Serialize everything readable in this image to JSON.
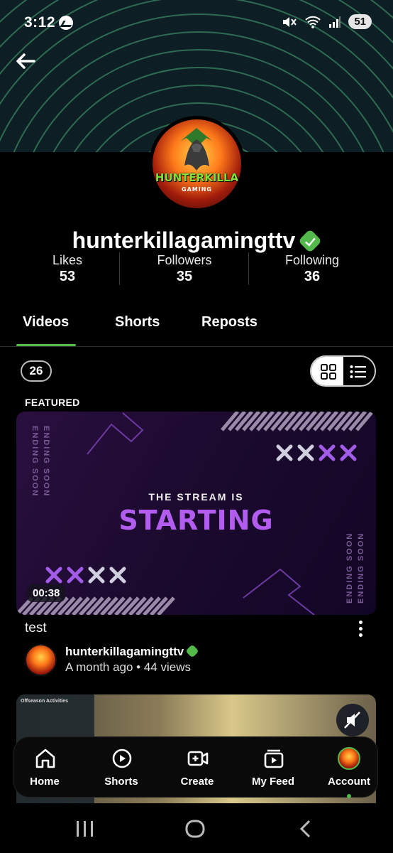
{
  "status_bar": {
    "time": "3:12",
    "battery": "51",
    "icons": [
      "messenger-icon",
      "mute-icon",
      "wifi-icon",
      "signal-icon"
    ]
  },
  "profile": {
    "avatar_text": "HUNTERKILLA",
    "avatar_subtext": "GAMING",
    "username": "hunterkillagamingttv",
    "verified": true,
    "stats": [
      {
        "label": "Likes",
        "value": "53"
      },
      {
        "label": "Followers",
        "value": "35"
      },
      {
        "label": "Following",
        "value": "36"
      }
    ]
  },
  "tabs": [
    {
      "label": "Videos",
      "active": true
    },
    {
      "label": "Shorts",
      "active": false
    },
    {
      "label": "Reposts",
      "active": false
    }
  ],
  "video_count": "26",
  "view_mode": "grid",
  "featured_label": "FEATURED",
  "featured_video": {
    "thumb_heading": "THE STREAM IS",
    "thumb_title": "STARTING",
    "thumb_side_text": "ENDING SOON",
    "duration": "00:38",
    "title": "test",
    "channel": "hunterkillagamingttv",
    "meta": "A month ago • 44 views"
  },
  "second_video": {
    "panel_title": "Offseason Activities"
  },
  "bottom_nav": [
    {
      "label": "Home",
      "icon": "home-icon"
    },
    {
      "label": "Shorts",
      "icon": "shorts-icon"
    },
    {
      "label": "Create",
      "icon": "create-video-icon"
    },
    {
      "label": "My Feed",
      "icon": "feed-icon"
    },
    {
      "label": "Account",
      "icon": "account-avatar"
    }
  ],
  "colors": {
    "accent": "#53b94a",
    "banner": "#0d1f24",
    "banner_lines": "#2e6b52",
    "thumb_purple": "#b35cf0"
  }
}
